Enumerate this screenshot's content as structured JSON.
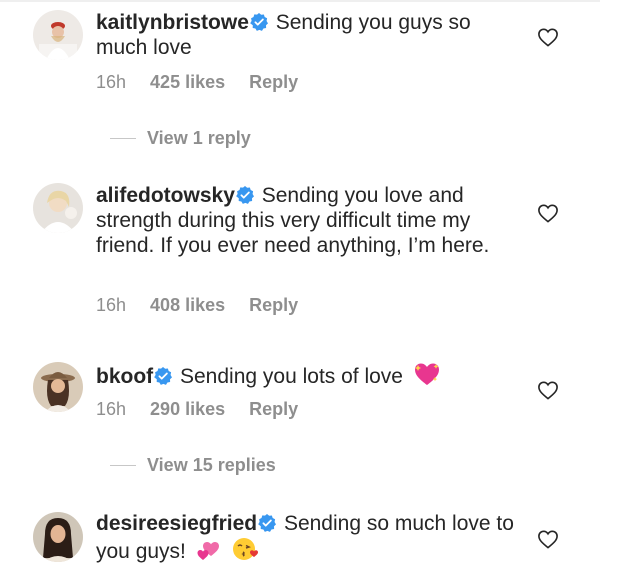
{
  "comments": [
    {
      "username": "kaitlynbristowe",
      "text": "Sending you guys so much love",
      "time": "16h",
      "likes": "425 likes",
      "reply": "Reply",
      "view_replies": "View 1 reply"
    },
    {
      "username": "alifedotowsky",
      "text": "Sending you love and strength during this very difficult time my friend. If you ever need anything, I’m here.",
      "time": "16h",
      "likes": "408 likes",
      "reply": "Reply"
    },
    {
      "username": "bkoof",
      "text": "Sending you lots of love",
      "emoji": "sparkling-heart",
      "time": "16h",
      "likes": "290 likes",
      "reply": "Reply",
      "view_replies": "View 15 replies"
    },
    {
      "username": "desireesiegfried",
      "text": "Sending so much love to you guys!",
      "emoji": [
        "two-hearts",
        "face-blowing-kiss"
      ]
    }
  ],
  "colors": {
    "verified": "#3897f0",
    "meta_gray": "#8e8e8e",
    "text": "#262626"
  }
}
